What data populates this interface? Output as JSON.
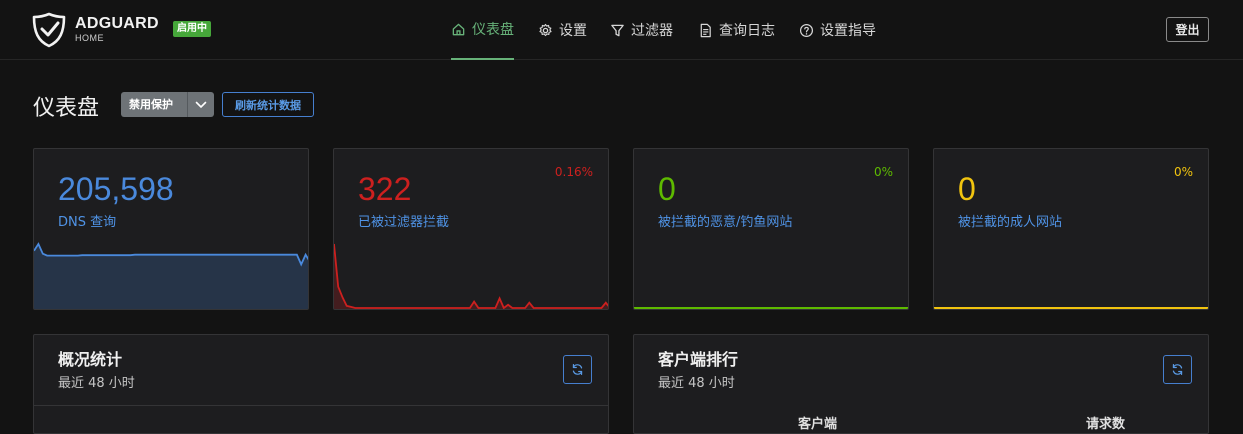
{
  "brand": {
    "name": "ADGUARD",
    "sub": "HOME",
    "status": "启用中",
    "status_color": "#46a73a"
  },
  "nav": {
    "items": [
      {
        "label": "仪表盘",
        "icon": "home-icon",
        "active": true
      },
      {
        "label": "设置",
        "icon": "gear-icon",
        "active": false
      },
      {
        "label": "过滤器",
        "icon": "filter-icon",
        "active": false
      },
      {
        "label": "查询日志",
        "icon": "document-icon",
        "active": false
      },
      {
        "label": "设置指导",
        "icon": "help-circle-icon",
        "active": false
      }
    ],
    "logout": "登出"
  },
  "page": {
    "title": "仪表盘",
    "disable_protection": "禁用保护",
    "refresh_stats": "刷新统计数据"
  },
  "cards": [
    {
      "value": "205,598",
      "label": "DNS 查询",
      "percent": "",
      "color": "#4a89dc",
      "sparkline": [
        118,
        132,
        112,
        108,
        108,
        108,
        108,
        108,
        108,
        108,
        108,
        109,
        109,
        109,
        109,
        109,
        109,
        109,
        109,
        109,
        109,
        109,
        109,
        110,
        110,
        110,
        110,
        110,
        110,
        110,
        110,
        110,
        110,
        110,
        110,
        110,
        110,
        110,
        110,
        110,
        110,
        110,
        110,
        110,
        110,
        110,
        110,
        110,
        110,
        110,
        110,
        110,
        110,
        110,
        110,
        110,
        110,
        110,
        110,
        110,
        110,
        90,
        110,
        95
      ]
    },
    {
      "value": "322",
      "label": "已被过滤器拦截",
      "percent": "0.16%",
      "color": "#cd201f",
      "sparkline": [
        60,
        20,
        10,
        2,
        1,
        0,
        0,
        0,
        0,
        0,
        0,
        0,
        0,
        0,
        0,
        0,
        0,
        0,
        0,
        0,
        0,
        0,
        0,
        0,
        0,
        0,
        0,
        0,
        0,
        0,
        0,
        0,
        0,
        6,
        0,
        0,
        0,
        0,
        0,
        9,
        0,
        3,
        0,
        0,
        0,
        0,
        5,
        0,
        0,
        0,
        0,
        0,
        0,
        0,
        0,
        0,
        0,
        0,
        0,
        0,
        0,
        0,
        0,
        0,
        5,
        0
      ]
    },
    {
      "value": "0",
      "label": "被拦截的恶意/钓鱼网站",
      "percent": "0%",
      "color": "#5eba00"
    },
    {
      "value": "0",
      "label": "被拦截的成人网站",
      "percent": "0%",
      "color": "#f1c40f"
    }
  ],
  "panels": {
    "stats": {
      "title": "概况统计",
      "subtitle": "最近 48 小时"
    },
    "clients": {
      "title": "客户端排行",
      "subtitle": "最近 48 小时",
      "col_client": "客户端",
      "col_requests": "请求数"
    }
  }
}
